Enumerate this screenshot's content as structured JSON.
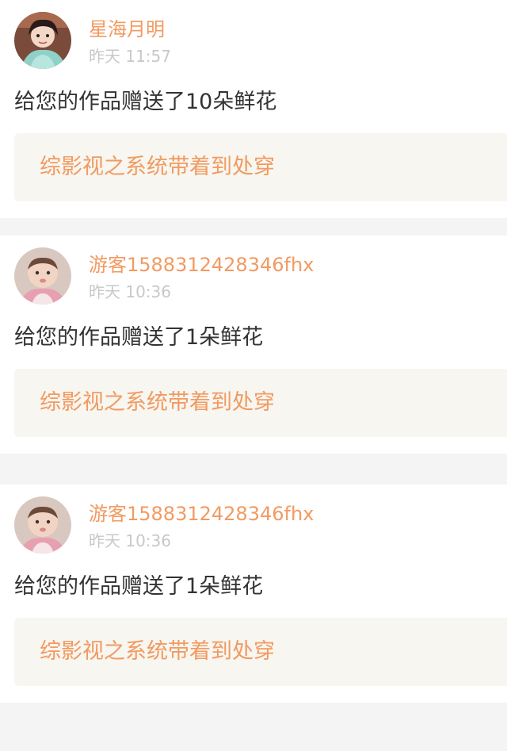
{
  "notifications": [
    {
      "username": "星海月明",
      "time": "昨天 11:57",
      "message": "给您的作品赠送了10朵鲜花",
      "work_title": "综影视之系统带着到处穿",
      "avatar_icon": "girl-avatar-icon"
    },
    {
      "username": "游客1588312428346fhx",
      "time": "昨天 10:36",
      "message": "给您的作品赠送了1朵鲜花",
      "work_title": "综影视之系统带着到处穿",
      "avatar_icon": "baby-avatar-icon"
    },
    {
      "username": "游客1588312428346fhx",
      "time": "昨天 10:36",
      "message": "给您的作品赠送了1朵鲜花",
      "work_title": "综影视之系统带着到处穿",
      "avatar_icon": "baby-avatar-icon"
    }
  ],
  "colors": {
    "accent": "#f29a61",
    "time_text": "#c8c8c8",
    "body_text": "#333333",
    "link_bg": "#f7f6f0",
    "page_bg": "#f4f4f4"
  }
}
